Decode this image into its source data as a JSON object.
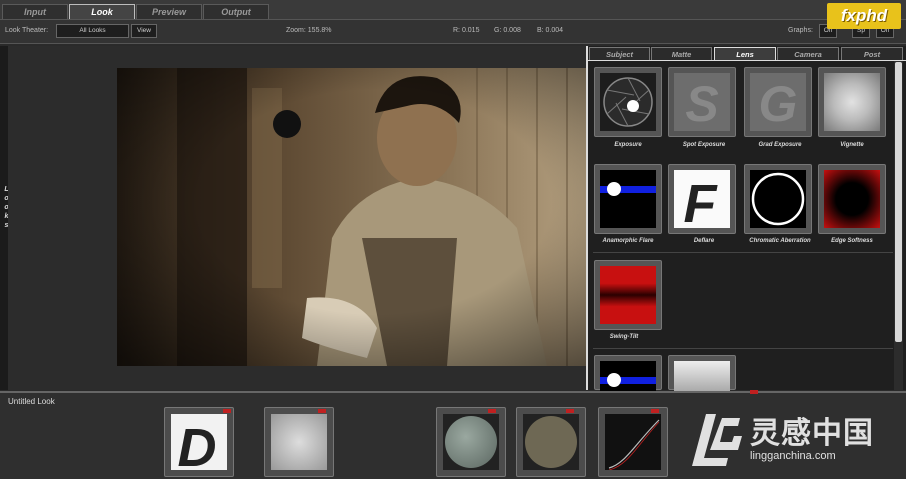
{
  "main_tabs": [
    "Input",
    "Look",
    "Preview",
    "Output"
  ],
  "active_main_tab": "Look",
  "brand": "fxphd",
  "toolbar": {
    "look_theater_label": "Look Theater:",
    "look_select_value": "All Looks",
    "view_button": "View",
    "zoom": "Zoom: 155.8%",
    "r": "R: 0.015",
    "g": "G: 0.008",
    "b": "B: 0.004",
    "graphs_label": "Graphs:",
    "graphs_buttons": [
      "Off",
      "Sp",
      "Off"
    ]
  },
  "side_label": "Looks",
  "panel_tabs": [
    "Subject",
    "Matte",
    "Lens",
    "Camera",
    "Post"
  ],
  "active_panel_tab": "Lens",
  "lens_tools": [
    {
      "label": "Exposure",
      "icon": "aperture-icon"
    },
    {
      "label": "Spot Exposure",
      "icon": "letter-s-icon"
    },
    {
      "label": "Grad Exposure",
      "icon": "letter-g-icon"
    },
    {
      "label": "Vignette",
      "icon": "vignette-icon"
    },
    {
      "label": "Anamorphic Flare",
      "icon": "anamorphic-flare-icon"
    },
    {
      "label": "Deflare",
      "icon": "letter-f-icon"
    },
    {
      "label": "Chromatic Aberration",
      "icon": "ring-icon"
    },
    {
      "label": "Edge Softness",
      "icon": "edge-softness-icon"
    },
    {
      "label": "Swing-Tilt",
      "icon": "swing-tilt-icon"
    }
  ],
  "look_title": "Untitled Look",
  "watermark": {
    "cn": "灵感中国",
    "en": "lingganchina.com"
  },
  "colors": {
    "accent_yellow": "#e8c21b",
    "flare_blue": "#1020e0",
    "edge_red": "#c81010",
    "marker_red": "#c02020"
  }
}
